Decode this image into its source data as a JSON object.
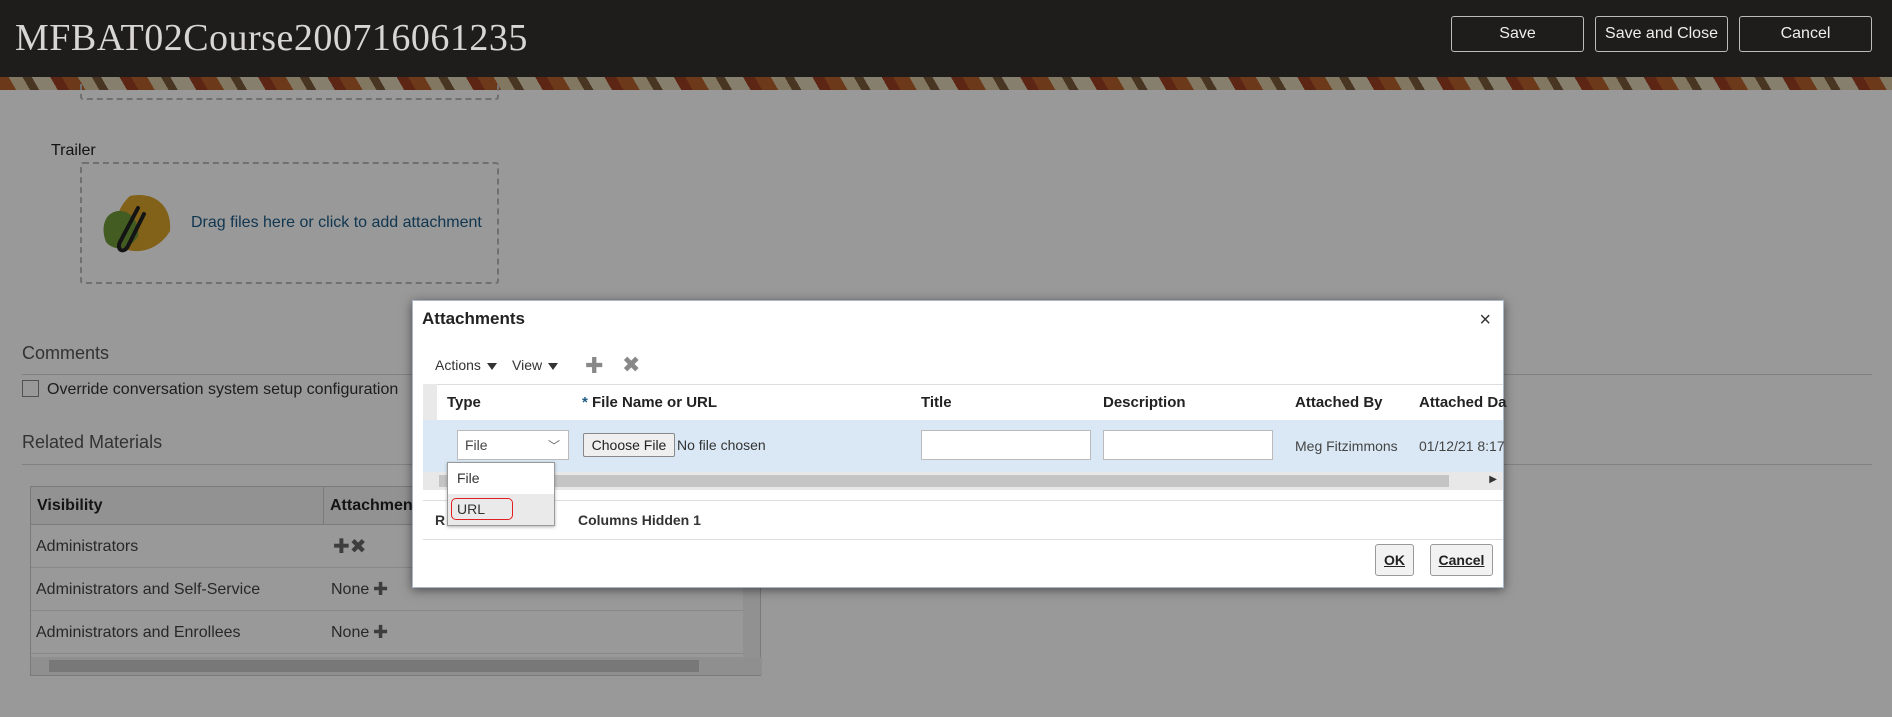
{
  "header": {
    "title": "MFBAT02Course200716061235",
    "buttons": {
      "save": "Save",
      "save_close": "Save and Close",
      "cancel": "Cancel"
    }
  },
  "page": {
    "trailer_label": "Trailer",
    "drop_text": "Drag files here or click to add attachment",
    "comments_header": "Comments",
    "override_label": "Override conversation system setup configuration",
    "related_header": "Related Materials",
    "table": {
      "columns": [
        "Visibility",
        "Attachmen"
      ],
      "rows": [
        {
          "visibility": "Administrators",
          "attachment": ""
        },
        {
          "visibility": "Administrators and Self-Service",
          "attachment": "None"
        },
        {
          "visibility": "Administrators and Enrollees",
          "attachment": "None"
        }
      ]
    }
  },
  "dialog": {
    "title": "Attachments",
    "close_icon": "×",
    "toolbar": {
      "actions": "Actions",
      "view": "View"
    },
    "columns": {
      "type": "Type",
      "required_mark": "*",
      "file": "File Name or URL",
      "title": "Title",
      "description": "Description",
      "attached_by": "Attached By",
      "attached_date": "Attached Da"
    },
    "row": {
      "type_value": "File",
      "choose_file": "Choose File",
      "no_file": "No file chosen",
      "attached_by": "Meg Fitzimmons",
      "attached_date": "01/12/21 8:17"
    },
    "dropdown_options": [
      "File",
      "URL"
    ],
    "status": {
      "rows_label": "R",
      "columns_hidden": "Columns Hidden  1"
    },
    "buttons": {
      "ok": "OK",
      "cancel": "Cancel"
    }
  },
  "colors": {
    "header_bg": "#1f1d1b",
    "link": "#1d5a86",
    "selected_row": "#dae8f5",
    "highlight": "#e02020"
  }
}
